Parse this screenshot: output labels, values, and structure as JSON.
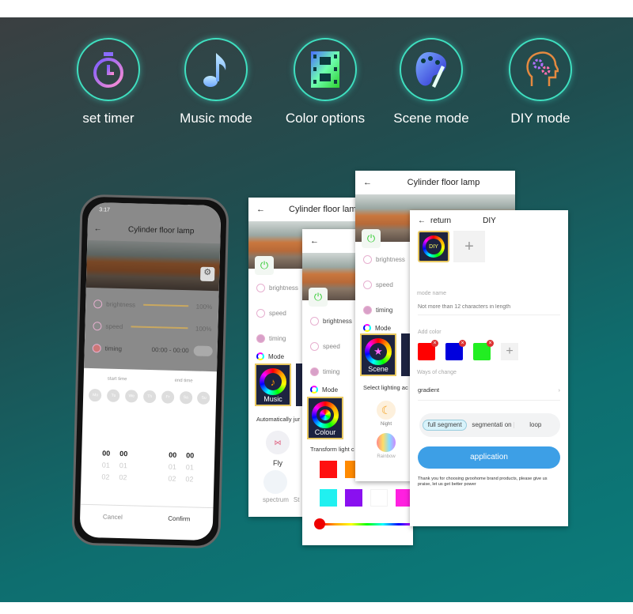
{
  "features": [
    {
      "label": "set timer",
      "icon": "stopwatch-icon"
    },
    {
      "label": "Music mode",
      "icon": "music-note-icon"
    },
    {
      "label": "Color options",
      "icon": "film-strip-icon"
    },
    {
      "label": "Scene mode",
      "icon": "palette-icon"
    },
    {
      "label": "DIY mode",
      "icon": "head-gears-icon"
    }
  ],
  "phone": {
    "status_time": "3:17",
    "title": "Cylinder floor lamp",
    "brightness_label": "brightness",
    "brightness_value": "100%",
    "speed_label": "speed",
    "speed_value": "100%",
    "timing_label": "timing",
    "timing_value": "00:00 - 00:00",
    "start_time": "start time",
    "end_time": "end time",
    "days": [
      "Mo",
      "Tu",
      "We",
      "Th",
      "Fr",
      "Sa",
      "Su"
    ],
    "picker_start": {
      "h": [
        "00",
        "01",
        "02"
      ],
      "m": [
        "00",
        "01",
        "02"
      ]
    },
    "picker_end": {
      "h": [
        "00",
        "01",
        "02"
      ],
      "m": [
        "00",
        "01",
        "02"
      ]
    },
    "cancel": "Cancel",
    "confirm": "Confirm"
  },
  "screen_music": {
    "title": "Cylinder floor lamp",
    "brightness": "brightness",
    "speed": "speed",
    "timing": "timing",
    "mode": "Mode",
    "tile": "Music",
    "caption": "Automatically jur",
    "items": [
      "Fly",
      "fla",
      "spectrum",
      "St"
    ]
  },
  "screen_colour": {
    "title": "C",
    "brightness": "brightness",
    "speed": "speed",
    "timing": "timing",
    "mode": "Mode",
    "tile": "Colour",
    "caption": "Transform light c",
    "swatches": [
      "#ff1010",
      "#ff8a00",
      "#20f0f0",
      "#8a10f0",
      "#ffffff",
      "#ff20e0"
    ],
    "slider_value": 0
  },
  "screen_scene": {
    "title": "Cylinder floor lamp",
    "brightness": "brightness",
    "speed": "speed",
    "timing": "timing",
    "mode": "Mode",
    "tile": "Scene",
    "caption": "Select lighting ac",
    "items": [
      "Night",
      "Rainbow"
    ]
  },
  "screen_diy": {
    "return": "return",
    "title": "DIY",
    "tile": "DIY",
    "mode_name_label": "mode name",
    "mode_name_placeholder": "Not more than 12 characters in length",
    "add_color_label": "Add color",
    "colors": [
      "#ff0000",
      "#0000dd",
      "#22ee22"
    ],
    "ways_label": "Ways of change",
    "ways_value": "gradient",
    "segments": [
      "full segment",
      "segmentati on",
      "loop"
    ],
    "selected_segment": "full segment",
    "apply": "application",
    "footer": "Thank you for choosing gvoohome brand products, please give us praise, let us get better power",
    "accent": "#3d9fe6"
  }
}
